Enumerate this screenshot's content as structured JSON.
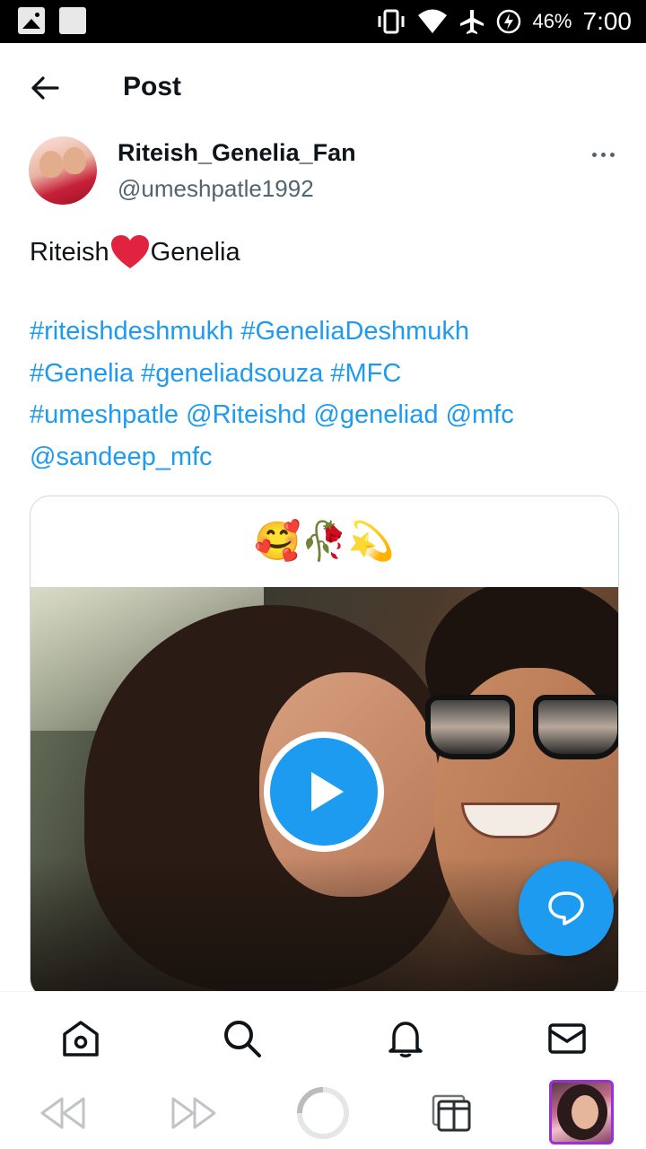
{
  "status_bar": {
    "battery_percent": "46%",
    "time": "7:00",
    "icons": [
      "image-icon",
      "square-icon",
      "vibrate-icon",
      "wifi-icon",
      "airplane-icon",
      "battery-charging-icon"
    ]
  },
  "header": {
    "back_icon": "arrow-left-icon",
    "title": "Post"
  },
  "post": {
    "author_name": "Riteish_Genelia_Fan",
    "author_handle": "@umeshpatle1992",
    "more_icon": "more-horizontal-icon",
    "text_part1": "Riteish",
    "text_emoji": "heart-icon",
    "text_part2": "Genelia",
    "hashtags": [
      "#riteishdeshmukh",
      "#GeneliaDeshmukh",
      "#Genelia",
      "#geneliadsouza",
      "#MFC",
      "#umeshpatle",
      "@Riteishd",
      "@geneliad",
      "@mfc",
      "@sandeep_mfc"
    ],
    "media": {
      "caption_emoji": "🥰🥀💫",
      "type": "video",
      "play_icon": "play-icon"
    }
  },
  "fab_icon": "reply-bubble-icon",
  "accent_color": "#1d9bf0",
  "bottom_nav": [
    "home-icon",
    "search-icon",
    "bell-icon",
    "mail-icon"
  ],
  "browser_bar": [
    "rewind-icon",
    "fast-forward-icon",
    "reload-icon",
    "tabs-icon",
    "tab-thumbnail"
  ]
}
